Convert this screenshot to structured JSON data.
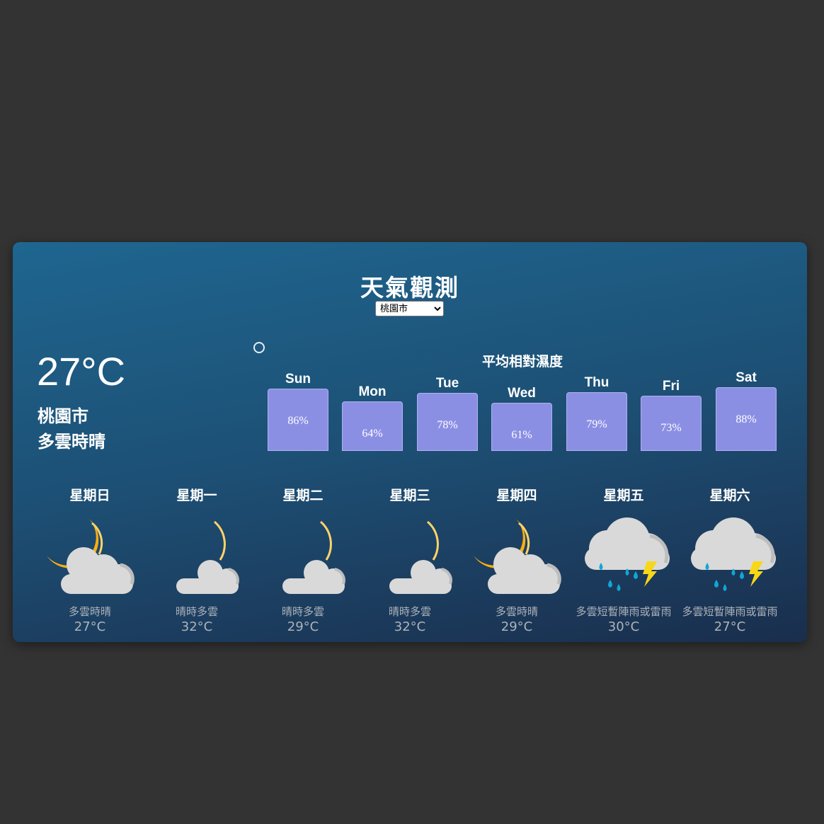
{
  "page": {
    "title": "天氣觀測"
  },
  "city_select": {
    "selected": "桃園市"
  },
  "current": {
    "temp": "27°C",
    "city": "桃園市",
    "description": "多雲時晴"
  },
  "humidity_chart": {
    "title": "平均相對濕度",
    "bar_color": "#8b8fe4",
    "days": [
      {
        "label": "Sun",
        "value": "86%"
      },
      {
        "label": "Mon",
        "value": "64%"
      },
      {
        "label": "Tue",
        "value": "78%"
      },
      {
        "label": "Wed",
        "value": "61%"
      },
      {
        "label": "Thu",
        "value": "79%"
      },
      {
        "label": "Fri",
        "value": "73%"
      },
      {
        "label": "Sat",
        "value": "88%"
      }
    ]
  },
  "chart_data": {
    "type": "bar",
    "title": "平均相對濕度",
    "categories": [
      "Sun",
      "Mon",
      "Tue",
      "Wed",
      "Thu",
      "Fri",
      "Sat"
    ],
    "values": [
      86,
      64,
      78,
      61,
      79,
      73,
      88
    ],
    "unit": "%"
  },
  "forecast": [
    {
      "day": "星期日",
      "icon": "moon-cloud-icon",
      "desc": "多雲時晴",
      "temp": "27°C"
    },
    {
      "day": "星期一",
      "icon": "moon-small-cloud-icon",
      "desc": "晴時多雲",
      "temp": "32°C"
    },
    {
      "day": "星期二",
      "icon": "moon-small-cloud-icon",
      "desc": "晴時多雲",
      "temp": "29°C"
    },
    {
      "day": "星期三",
      "icon": "moon-small-cloud-icon",
      "desc": "晴時多雲",
      "temp": "32°C"
    },
    {
      "day": "星期四",
      "icon": "moon-cloud-icon",
      "desc": "多雲時晴",
      "temp": "29°C"
    },
    {
      "day": "星期五",
      "icon": "thunder-rain-icon",
      "desc": "多雲短暫陣雨或雷雨",
      "temp": "30°C"
    },
    {
      "day": "星期六",
      "icon": "thunder-rain-icon",
      "desc": "多雲短暫陣雨或雷雨",
      "temp": "27°C"
    }
  ]
}
